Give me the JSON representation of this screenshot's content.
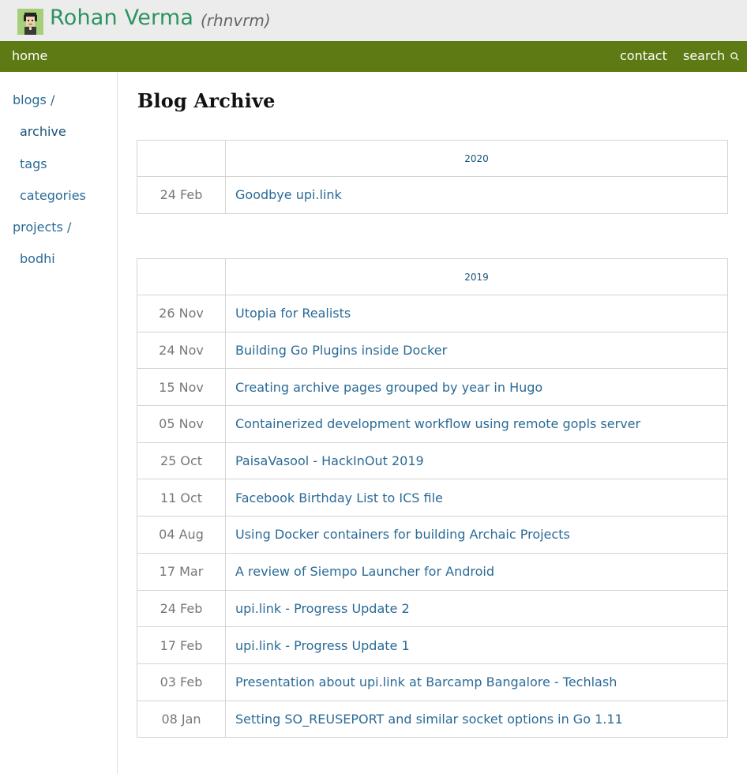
{
  "header": {
    "site_name": "Rohan Verma",
    "handle": "(rhnvrm)"
  },
  "nav": {
    "home": "home",
    "contact": "contact",
    "search": "search",
    "search_icon": "search-icon"
  },
  "sidebar": {
    "items": [
      {
        "label": "blogs /"
      },
      {
        "label": "archive"
      },
      {
        "label": "tags"
      },
      {
        "label": "categories"
      },
      {
        "label": "projects /"
      },
      {
        "label": "bodhi"
      }
    ]
  },
  "main": {
    "title": "Blog Archive",
    "years": [
      {
        "year": "2020",
        "posts": [
          {
            "date": "24 Feb",
            "title": "Goodbye upi.link"
          }
        ]
      },
      {
        "year": "2019",
        "posts": [
          {
            "date": "26 Nov",
            "title": "Utopia for Realists"
          },
          {
            "date": "24 Nov",
            "title": "Building Go Plugins inside Docker"
          },
          {
            "date": "15 Nov",
            "title": "Creating archive pages grouped by year in Hugo"
          },
          {
            "date": "05 Nov",
            "title": "Containerized development workflow using remote gopls server"
          },
          {
            "date": "25 Oct",
            "title": "PaisaVasool - HackInOut 2019"
          },
          {
            "date": "11 Oct",
            "title": "Facebook Birthday List to ICS file"
          },
          {
            "date": "04 Aug",
            "title": "Using Docker containers for building Archaic Projects"
          },
          {
            "date": "17 Mar",
            "title": "A review of Siempo Launcher for Android"
          },
          {
            "date": "24 Feb",
            "title": "upi.link - Progress Update 2"
          },
          {
            "date": "17 Feb",
            "title": "upi.link - Progress Update 1"
          },
          {
            "date": "03 Feb",
            "title": "Presentation about upi.link at Barcamp Bangalore - Techlash"
          },
          {
            "date": "08 Jan",
            "title": "Setting SO_REUSEPORT and similar socket options in Go 1.11"
          }
        ]
      }
    ]
  },
  "colors": {
    "brand_green": "#2a9461",
    "nav_bg": "#5d7a15",
    "link": "#2a6a96"
  }
}
